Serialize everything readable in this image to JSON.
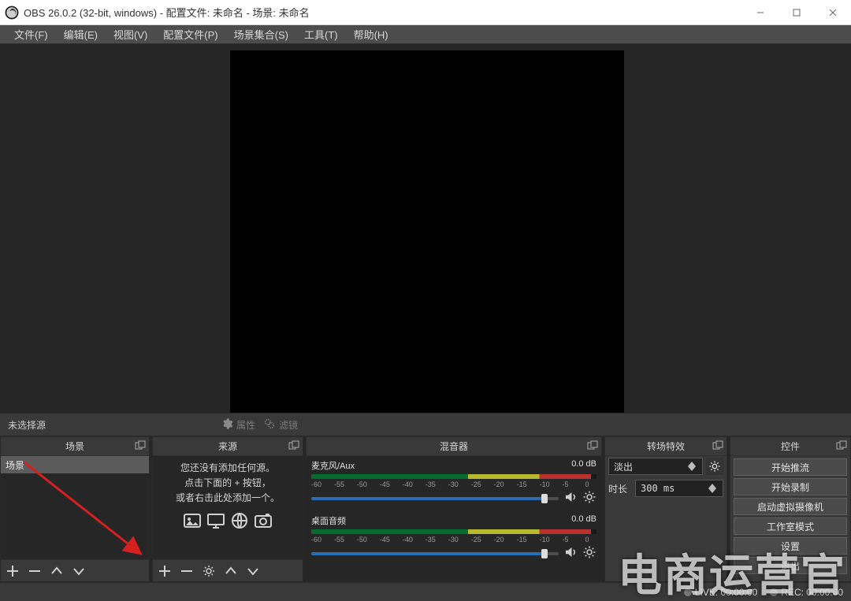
{
  "window": {
    "title": "OBS 26.0.2 (32-bit, windows) - 配置文件: 未命名 - 场景: 未命名"
  },
  "menu": {
    "file": "文件(F)",
    "edit": "编辑(E)",
    "view": "视图(V)",
    "profile": "配置文件(P)",
    "scenes": "场景集合(S)",
    "tools": "工具(T)",
    "help": "帮助(H)"
  },
  "toolbar": {
    "no_selection": "未选择源",
    "properties": "属性",
    "filters": "滤镜"
  },
  "docks": {
    "scenes": "场景",
    "sources": "来源",
    "mixer": "混音器",
    "transitions": "转场特效",
    "controls": "控件"
  },
  "scenes": {
    "items": [
      "场景"
    ]
  },
  "sources": {
    "hint_line1": "您还没有添加任何源。",
    "hint_line2": "点击下面的 + 按钮，",
    "hint_line3": "或者右击此处添加一个。"
  },
  "mixer": {
    "channels": [
      {
        "name": "麦克风/Aux",
        "level": "0.0 dB",
        "fill_pct": 93
      },
      {
        "name": "桌面音频",
        "level": "0.0 dB",
        "fill_pct": 93
      }
    ],
    "scale_labels": [
      "-60",
      "-55",
      "-50",
      "-45",
      "-40",
      "-35",
      "-30",
      "-25",
      "-20",
      "-15",
      "-10",
      "-5",
      "0"
    ]
  },
  "transitions": {
    "selected": "淡出",
    "duration_label": "时长",
    "duration_value": "300 ms"
  },
  "controls": {
    "start_stream": "开始推流",
    "start_record": "开始录制",
    "start_vcam": "启动虚拟摄像机",
    "studio_mode": "工作室模式",
    "settings": "设置",
    "exit": "退出"
  },
  "statusbar": {
    "live": "LIVE: 00:00:00",
    "rec": "REC: 00:00:00"
  },
  "watermark": {
    "main": "电商运营官",
    "sub": ""
  }
}
